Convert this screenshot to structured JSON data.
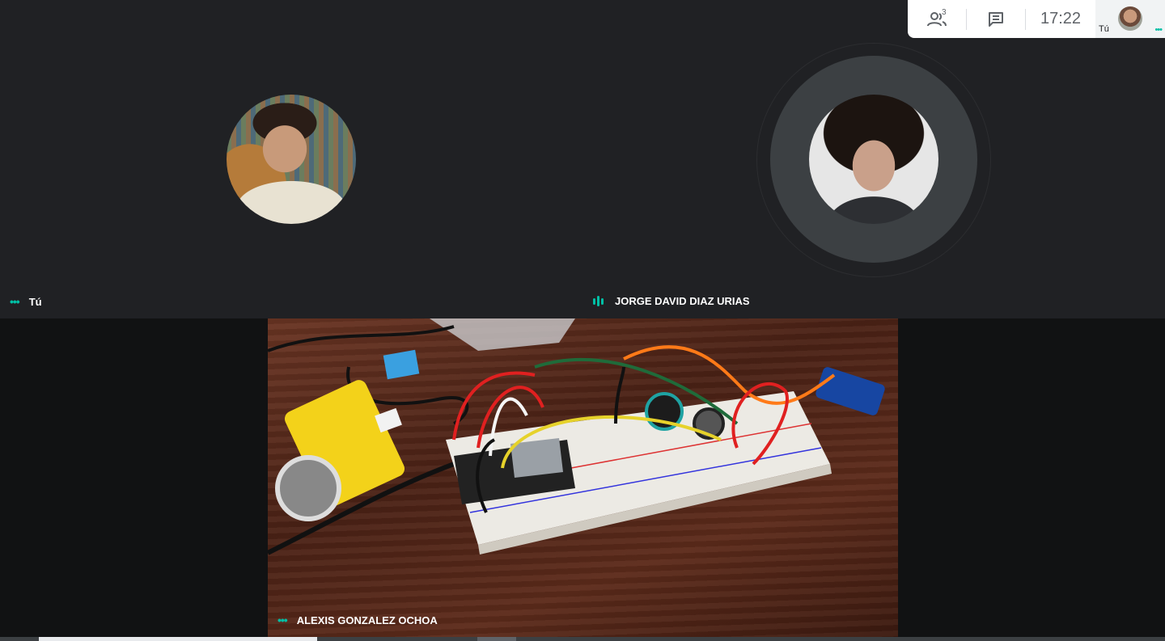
{
  "header": {
    "participant_count": "3",
    "clock": "17:22",
    "self_label": "Tú",
    "icons": [
      "people-icon",
      "chat-icon",
      "more-icon"
    ]
  },
  "participants": {
    "self_name": "Tú",
    "jorge_name": "JORGE DAVID DIAZ URIAS",
    "presenter_name": "ALEXIS GONZALEZ OCHOA"
  },
  "colors": {
    "background": "#202124",
    "presentation_bg": "#111213",
    "accent": "#00bfa5",
    "avatar_ring": "#3c4043"
  }
}
